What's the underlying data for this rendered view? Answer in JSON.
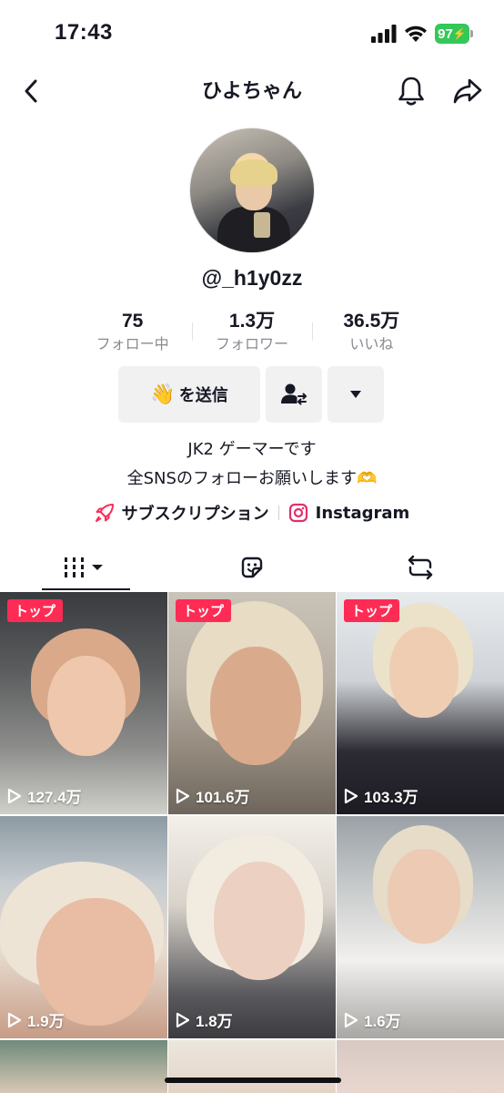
{
  "status_bar": {
    "time": "17:43",
    "battery": "97"
  },
  "header": {
    "title": "ひよちゃん",
    "back_icon": "chevron-left-icon",
    "bell_icon": "bell-icon",
    "share_icon": "share-arrow-icon"
  },
  "profile": {
    "username": "@_h1y0zz",
    "stats": [
      {
        "value": "75",
        "label": "フォロー中"
      },
      {
        "value": "1.3万",
        "label": "フォロワー"
      },
      {
        "value": "36.5万",
        "label": "いいね"
      }
    ],
    "message_button": {
      "emoji": "👋",
      "label": "を送信"
    },
    "bio_lines": [
      "JK2  ゲーマーです",
      "全SNSのフォローお願いします🫶"
    ],
    "links": [
      {
        "icon": "rocket-icon",
        "label": "サブスクリプション"
      },
      {
        "icon": "instagram-icon",
        "label": "Instagram"
      }
    ]
  },
  "tabs": [
    {
      "name": "videos",
      "icon": "grid-bars-icon"
    },
    {
      "name": "stickers",
      "icon": "sticker-icon"
    },
    {
      "name": "reposts",
      "icon": "repost-icon"
    }
  ],
  "videos": [
    {
      "badge": "トップ",
      "views": "127.4万"
    },
    {
      "badge": "トップ",
      "views": "101.6万"
    },
    {
      "badge": "トップ",
      "views": "103.3万"
    },
    {
      "badge": "",
      "views": "1.9万"
    },
    {
      "badge": "",
      "views": "1.8万"
    },
    {
      "badge": "",
      "views": "1.6万"
    }
  ],
  "colors": {
    "accent": "#fe2c55",
    "battery": "#34c759",
    "text": "#161823",
    "muted": "#8a8b91"
  }
}
